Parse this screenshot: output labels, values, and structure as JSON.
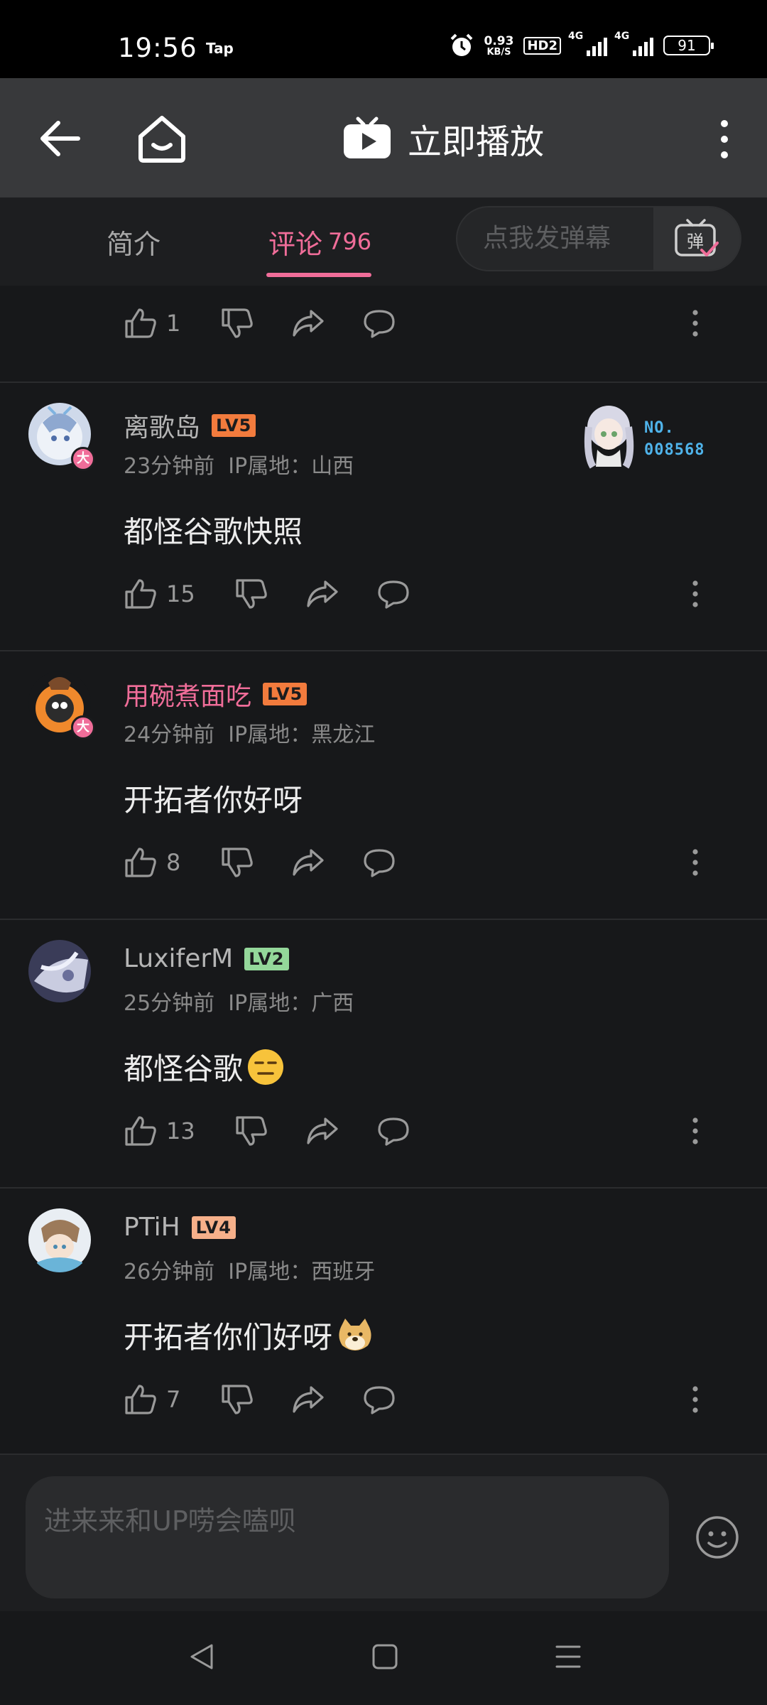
{
  "status_bar": {
    "time": "19:56",
    "tap_label": "Tap",
    "net_speed": "0.93",
    "net_speed_unit": "KB/S",
    "hd_label": "HD2",
    "net_1": "4G",
    "net_2": "4G",
    "battery": "91"
  },
  "header": {
    "play_label": "立即播放"
  },
  "tabs": {
    "intro": "简介",
    "comments": "评论",
    "comment_count": "796",
    "danmaku_placeholder": "点我发弹幕",
    "danmaku_button_glyph": "弹"
  },
  "top_partial": {
    "likes": "1"
  },
  "comments": [
    {
      "username": "离歌岛",
      "level": "LV5",
      "time": "23分钟前",
      "ip": "IP属地：山西",
      "text": "都怪谷歌快照",
      "likes": "15",
      "badge": "大",
      "fan_badge_no": "NO.",
      "fan_badge_num": "008568"
    },
    {
      "username": "用碗煮面吃",
      "level": "LV5",
      "time": "24分钟前",
      "ip": "IP属地：黑龙江",
      "text": "开拓者你好呀",
      "likes": "8",
      "badge": "大"
    },
    {
      "username": "LuxiferM",
      "level": "LV2",
      "time": "25分钟前",
      "ip": "IP属地：广西",
      "text": "都怪谷歌",
      "likes": "13",
      "emoji": "expressionless-face"
    },
    {
      "username": "PTiH",
      "level": "LV4",
      "time": "26分钟前",
      "ip": "IP属地：西班牙",
      "text": "开拓者你们好呀",
      "likes": "7",
      "emoji": "doge-face"
    }
  ],
  "reply": {
    "placeholder": "进来来和UP唠会嗑呗"
  },
  "colors": {
    "accent_pink": "#f06d99",
    "lv5": "#f27b3d",
    "lv2": "#94d79a",
    "lv4": "#f6b08a",
    "fan_badge_blue": "#4fb3ea"
  }
}
